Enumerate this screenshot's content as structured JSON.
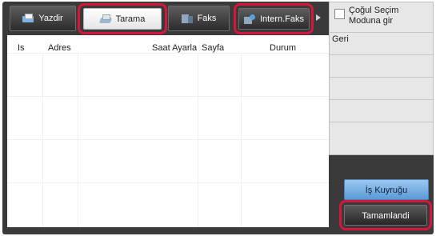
{
  "tabs": [
    {
      "label": "Yazdir",
      "icon": "printer-icon",
      "state": "normal"
    },
    {
      "label": "Tarama",
      "icon": "scanner-icon",
      "state": "selected"
    },
    {
      "label": "Faks",
      "icon": "fax-icon",
      "state": "normal"
    },
    {
      "label": "Intern.Faks",
      "icon": "internet-fax-icon",
      "state": "normal"
    }
  ],
  "more_tabs_icon": "right-arrow-icon",
  "side_menu": {
    "multi_select_label": "Çoğul Seçim Moduna gir",
    "multi_select_checked": false,
    "back_label": "Geri"
  },
  "table": {
    "columns": [
      "Is",
      "Adres",
      "Saat Ayarla",
      "Sayfa",
      "Durum"
    ],
    "rows": []
  },
  "buttons": {
    "queue_label": "İş Kuyruğu",
    "done_label": "Tamamlandi"
  },
  "colors": {
    "highlight_ring": "#d4173a",
    "queue_button": "#5b9ad6",
    "frame": "#3a3a3a"
  }
}
